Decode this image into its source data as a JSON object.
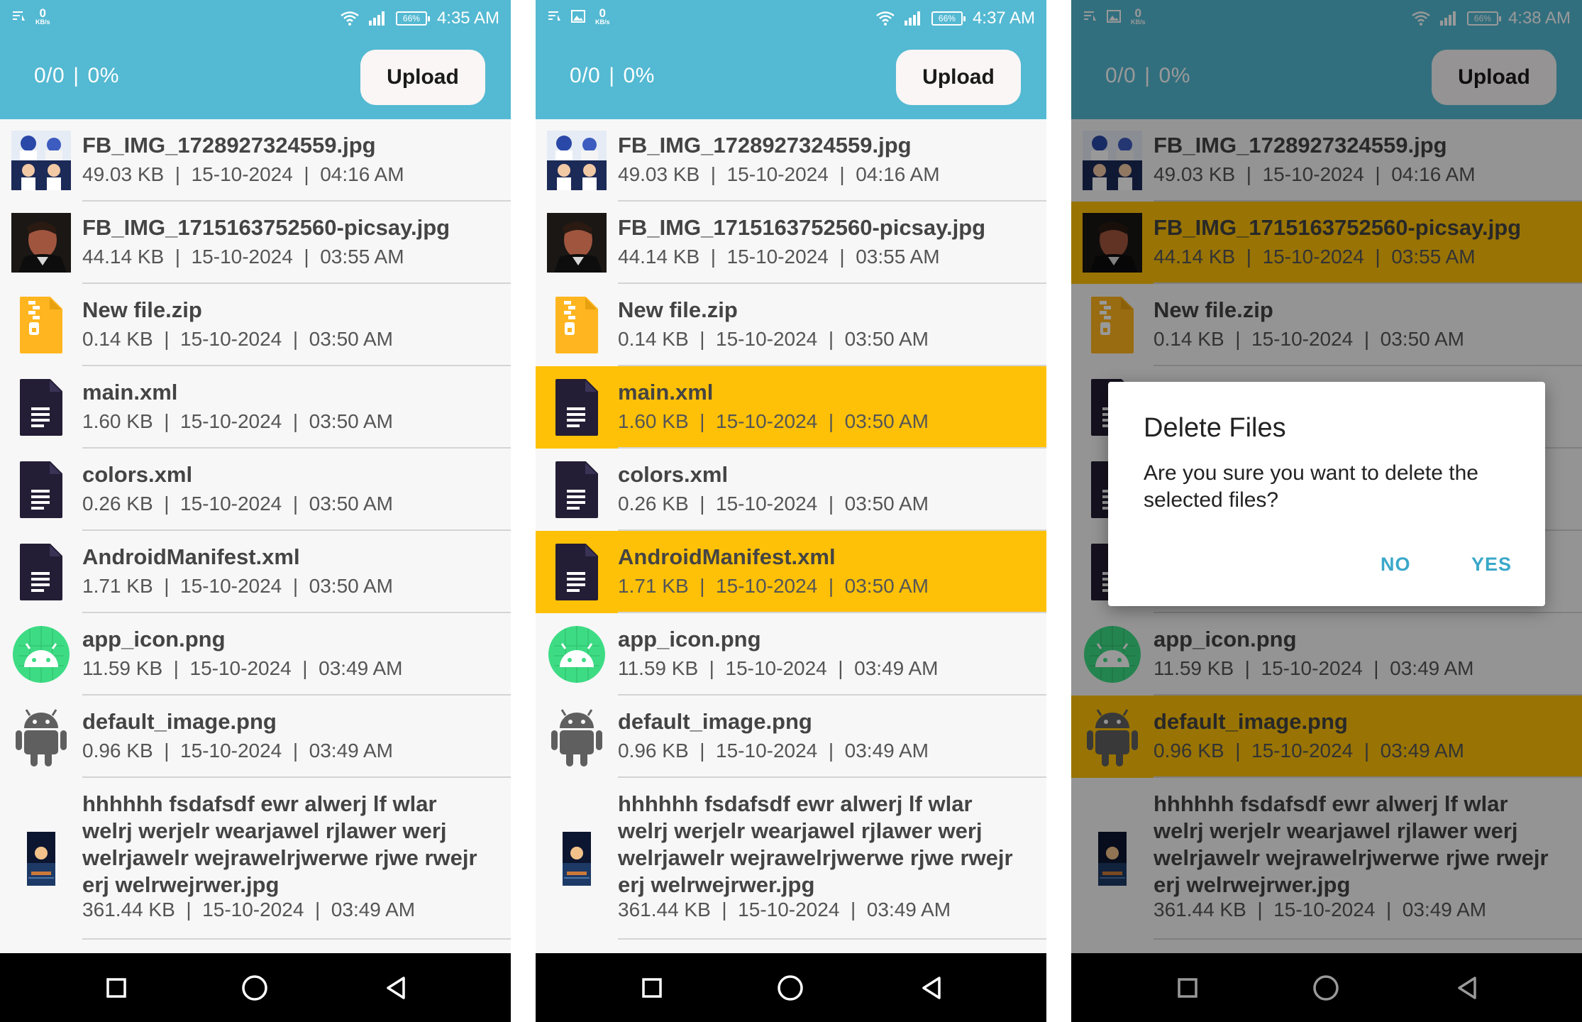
{
  "status_bars": [
    {
      "kbs_value": "0",
      "kbs_unit": "KB/s",
      "battery": "66%",
      "time": "4:35 AM"
    },
    {
      "kbs_value": "0",
      "kbs_unit": "KB/s",
      "battery": "66%",
      "time": "4:37 AM"
    },
    {
      "kbs_value": "0",
      "kbs_unit": "KB/s",
      "battery": "66%",
      "time": "4:38 AM"
    }
  ],
  "header": {
    "count": "0/0",
    "separator": "|",
    "percent": "0%",
    "upload_label": "Upload"
  },
  "files": [
    {
      "name": "FB_IMG_1728927324559.jpg",
      "size": "49.03 KB",
      "date": "15-10-2024",
      "time": "04:16 AM",
      "icon": "cartoon-photo-thumbnail"
    },
    {
      "name": "FB_IMG_1715163752560-picsay.jpg",
      "size": "44.14 KB",
      "date": "15-10-2024",
      "time": "03:55 AM",
      "icon": "portrait-photo-thumbnail"
    },
    {
      "name": "New file.zip",
      "size": "0.14 KB",
      "date": "15-10-2024",
      "time": "03:50 AM",
      "icon": "zip-file-icon"
    },
    {
      "name": "main.xml",
      "size": "1.60 KB",
      "date": "15-10-2024",
      "time": "03:50 AM",
      "icon": "document-icon"
    },
    {
      "name": "colors.xml",
      "size": "0.26 KB",
      "date": "15-10-2024",
      "time": "03:50 AM",
      "icon": "document-icon"
    },
    {
      "name": "AndroidManifest.xml",
      "size": "1.71 KB",
      "date": "15-10-2024",
      "time": "03:50 AM",
      "icon": "document-icon"
    },
    {
      "name": "app_icon.png",
      "size": "11.59 KB",
      "date": "15-10-2024",
      "time": "03:49 AM",
      "icon": "android-app-icon"
    },
    {
      "name": "default_image.png",
      "size": "0.96 KB",
      "date": "15-10-2024",
      "time": "03:49 AM",
      "icon": "android-robot-icon"
    },
    {
      "name": "hhhhhh fsdafsdf ewr alwerj lf wlar welrj werjelr wearjawel rjlawer werj welrjawelr wejrawelrjwerwe rjwe rwejr erj welrwejrwer.jpg",
      "size": "361.44 KB",
      "date": "15-10-2024",
      "time": "03:49 AM",
      "icon": "moon-photo-thumbnail"
    }
  ],
  "selections": [
    [],
    [
      3,
      5
    ],
    [
      1,
      7
    ]
  ],
  "dialog": {
    "title": "Delete Files",
    "message": "Are you sure you want to delete the selected files?",
    "no_label": "NO",
    "yes_label": "YES"
  },
  "colors": {
    "header": "#54b9d2",
    "selected": "#ffc107",
    "dialog_button": "#3aa8c9",
    "doc_icon": "#231d35",
    "zip_icon": "#ffb51f"
  }
}
